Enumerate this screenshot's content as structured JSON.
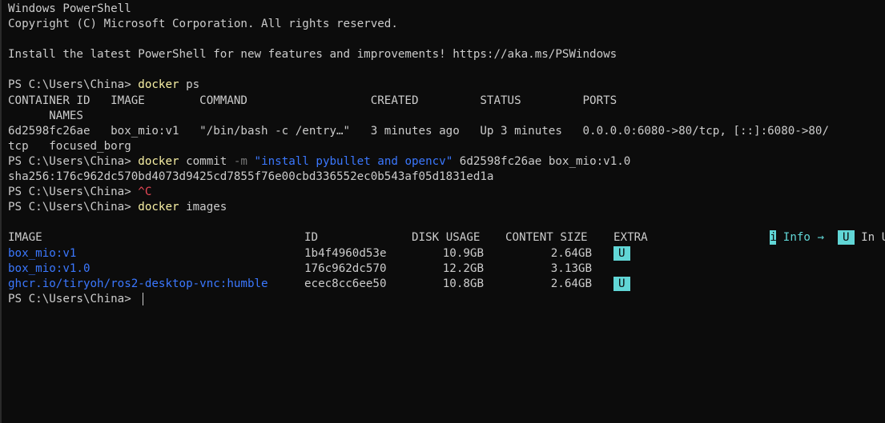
{
  "window": {
    "banner_title": "Windows PowerShell",
    "banner_copyright": "Copyright (C) Microsoft Corporation. All rights reserved.",
    "banner_install": "Install the latest PowerShell for new features and improvements! https://aka.ms/PSWindows"
  },
  "prompt": "PS C:\\Users\\China> ",
  "commands": {
    "ps": {
      "cmd": "docker",
      "args": " ps"
    },
    "commit": {
      "cmd": "docker",
      "verb": " commit ",
      "flag": "-m",
      "message": " \"install pybullet and opencv\"",
      "rest": " 6d2598fc26ae box_mio:v1.0"
    },
    "ctrl_c": "^C",
    "images": {
      "cmd": "docker",
      "args": " images"
    }
  },
  "ps_table": {
    "header_line1": "CONTAINER ID   IMAGE        COMMAND                  CREATED         STATUS         PORTS",
    "header_line2": "      NAMES",
    "row_line1": "6d2598fc26ae   box_mio:v1   \"/bin/bash -c /entry…\"   3 minutes ago   Up 3 minutes   0.0.0.0:6080->80/tcp, [::]:6080->80/",
    "row_line2": "tcp   focused_borg"
  },
  "commit_output": "sha256:176c962dc570bd4073d9425cd7855f76e00cbd336552ec0b543af05d1831ed1a",
  "images_legend": {
    "info_glyph": "i",
    "info_label": " Info →",
    "in_use_badge": "U",
    "in_use_label": " In Use"
  },
  "images_table": {
    "headers": {
      "image": "IMAGE",
      "id": "ID",
      "disk_usage": "DISK USAGE",
      "content_size": "CONTENT SIZE",
      "extra": "EXTRA"
    },
    "rows": [
      {
        "image": "box_mio:v1",
        "id": "1b4f4960d53e",
        "disk_usage": "10.9GB",
        "content_size": "2.64GB",
        "extra": "U"
      },
      {
        "image": "box_mio:v1.0",
        "id": "176c962dc570",
        "disk_usage": "12.2GB",
        "content_size": "3.13GB",
        "extra": ""
      },
      {
        "image": "ghcr.io/tiryoh/ros2-desktop-vnc:humble",
        "id": "ecec8cc6ee50",
        "disk_usage": "10.8GB",
        "content_size": "2.64GB",
        "extra": "U"
      }
    ]
  },
  "colors": {
    "background": "#0c0c0c",
    "foreground": "#cccccc",
    "command": "#f9f1a5",
    "string": "#3b78ff",
    "error": "#e74856",
    "badge": "#61d6d6"
  }
}
